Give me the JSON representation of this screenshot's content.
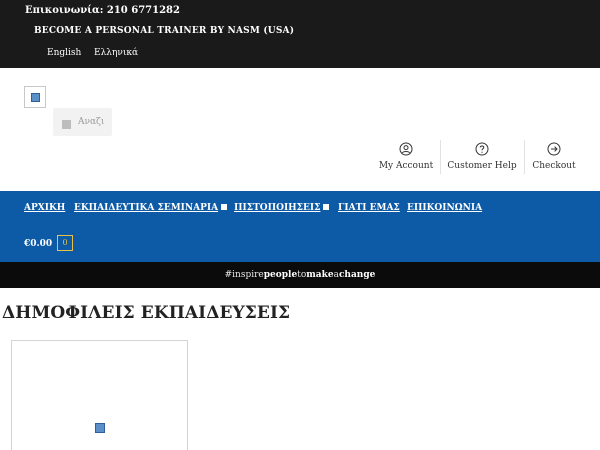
{
  "topbar": {
    "contact": "Επικοινωνία: 210 6771282",
    "promo": "BECOME A PERSONAL TRAINER BY NASM (USA)",
    "languages": [
      "English",
      "Ελληνικά"
    ]
  },
  "search": {
    "placeholder": "Αναζι"
  },
  "account_links": [
    {
      "label": "My Account",
      "icon": "user-circle-icon"
    },
    {
      "label": "Customer Help",
      "icon": "help-circle-icon"
    },
    {
      "label": "Checkout",
      "icon": "arrow-right-circle-icon"
    }
  ],
  "nav": {
    "items": [
      {
        "label": "ΑΡΧΙΚΗ"
      },
      {
        "label": "ΕΚΠΑΙΔΕΥΤΙΚΑ ΣΕΜΙΝΑΡΙΑ"
      },
      {
        "label": "ΠΙΣΤΟΠΟΙΗΣΕΙΣ"
      },
      {
        "label": "ΓΙΑΤΙ ΕΜΑΣ"
      },
      {
        "label": "ΕΠΙΚΟΙΝΩΝΙΑ"
      }
    ],
    "cart_total": "€0.00",
    "cart_count": "0"
  },
  "slogan": {
    "parts": [
      "#",
      "inspire",
      "people",
      "to",
      "make",
      "a",
      "change"
    ]
  },
  "section": {
    "title": "ΔΗΜΟΦΙΛΕΙΣ ΕΚΠΑΙΔΕΥΣΕΙΣ"
  },
  "colors": {
    "topbar_bg": "#1a1a1a",
    "nav_bg": "#0d5aa7",
    "slogan_bg": "#0b0b0b",
    "cart_badge_border": "#e8c04a"
  }
}
